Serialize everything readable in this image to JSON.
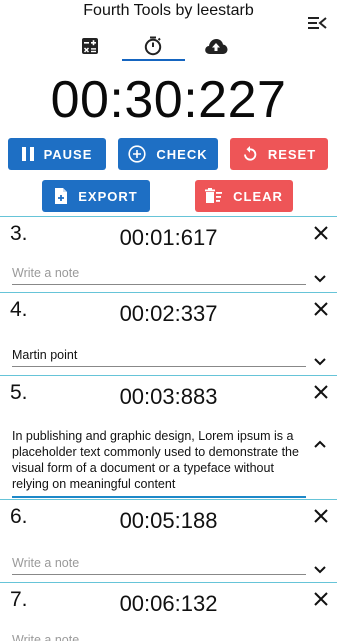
{
  "header": {
    "title": "Fourth Tools by leestarb",
    "tabs": [
      {
        "icon": "calculator-icon"
      },
      {
        "icon": "stopwatch-icon",
        "selected": true
      },
      {
        "icon": "cloud-upload-icon"
      }
    ]
  },
  "timer": {
    "display": "00:30:227"
  },
  "buttons": {
    "pause": "PAUSE",
    "check": "CHECK",
    "reset": "RESET",
    "export": "EXPORT",
    "clear": "CLEAR"
  },
  "colors": {
    "blue": "#1e6fc4",
    "red": "#ee5557",
    "divider": "#66c4d8",
    "accent": "#1565c0"
  },
  "laps": [
    {
      "index": "3.",
      "time": "00:01:617",
      "note": "",
      "placeholder": "Write a note",
      "expanded": false
    },
    {
      "index": "4.",
      "time": "00:02:337",
      "note": "Martin point",
      "placeholder": "Write a note",
      "expanded": false
    },
    {
      "index": "5.",
      "time": "00:03:883",
      "note": "In publishing and graphic design, Lorem ipsum is a placeholder text commonly used to demonstrate the visual form of a document or a typeface without relying on meaningful content",
      "placeholder": "Write a note",
      "expanded": true
    },
    {
      "index": "6.",
      "time": "00:05:188",
      "note": "",
      "placeholder": "Write a note",
      "expanded": false
    },
    {
      "index": "7.",
      "time": "00:06:132",
      "note": "",
      "placeholder": "Write a note",
      "expanded": false
    }
  ]
}
